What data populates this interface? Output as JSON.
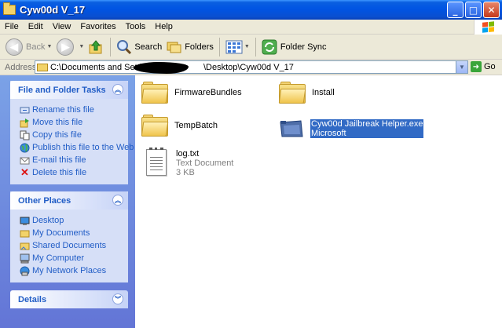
{
  "window": {
    "title": "Cyw00d V_17"
  },
  "menu": [
    "File",
    "Edit",
    "View",
    "Favorites",
    "Tools",
    "Help"
  ],
  "toolbar": {
    "back": "Back",
    "search": "Search",
    "folders": "Folders",
    "folder_sync": "Folder Sync"
  },
  "address": {
    "label": "Address",
    "path_start": "C:\\Documents and Settings\\",
    "path_end": "\\Desktop\\Cyw00d V_17",
    "go": "Go"
  },
  "file_tasks": {
    "title": "File and Folder Tasks",
    "items": [
      "Rename this file",
      "Move this file",
      "Copy this file",
      "Publish this file to the Web",
      "E-mail this file",
      "Delete this file"
    ]
  },
  "other_places": {
    "title": "Other Places",
    "items": [
      "Desktop",
      "My Documents",
      "Shared Documents",
      "My Computer",
      "My Network Places"
    ]
  },
  "details": {
    "title": "Details"
  },
  "files": {
    "firmware": "FirmwareBundles",
    "install": "Install",
    "tempbatch": "TempBatch",
    "exe_name": "Cyw00d Jailbreak Helper.exe",
    "exe_company": "Microsoft",
    "log_name": "log.txt",
    "log_type": "Text Document",
    "log_size": "3 KB"
  }
}
